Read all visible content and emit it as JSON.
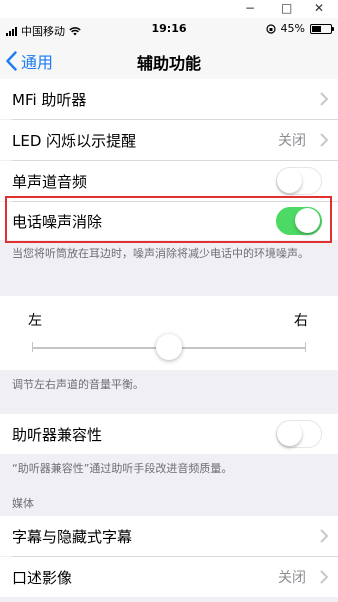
{
  "window": {
    "minimize": "−",
    "maximize": "□",
    "close": "✕"
  },
  "status_bar": {
    "carrier": "中国移动",
    "time": "19:16",
    "battery_percent": "45%",
    "battery_level": 0.45
  },
  "nav": {
    "back_label": "通用",
    "title": "辅助功能"
  },
  "rows": {
    "mfi": {
      "label": "MFi 助听器"
    },
    "led": {
      "label": "LED 闪烁以示提醒",
      "value": "关闭"
    },
    "mono": {
      "label": "单声道音频",
      "on": false
    },
    "noise": {
      "label": "电话噪声消除",
      "on": true
    },
    "hac": {
      "label": "助听器兼容性",
      "on": false
    },
    "subtitles": {
      "label": "字幕与隐藏式字幕"
    },
    "audio_desc": {
      "label": "口述影像",
      "value": "关闭"
    }
  },
  "notes": {
    "noise": "当您将听筒放在耳边时，噪声消除将减少电话中的环境噪声。",
    "balance": "调节左右声道的音量平衡。",
    "hac": "“助听器兼容性”通过助听手段改进音频质量。",
    "media_header": "媒体"
  },
  "balance": {
    "left_label": "左",
    "right_label": "右",
    "value": 0.5
  },
  "colors": {
    "accent": "#1d7cf2",
    "toggle_on": "#4cd964",
    "highlight": "#e0312f"
  }
}
